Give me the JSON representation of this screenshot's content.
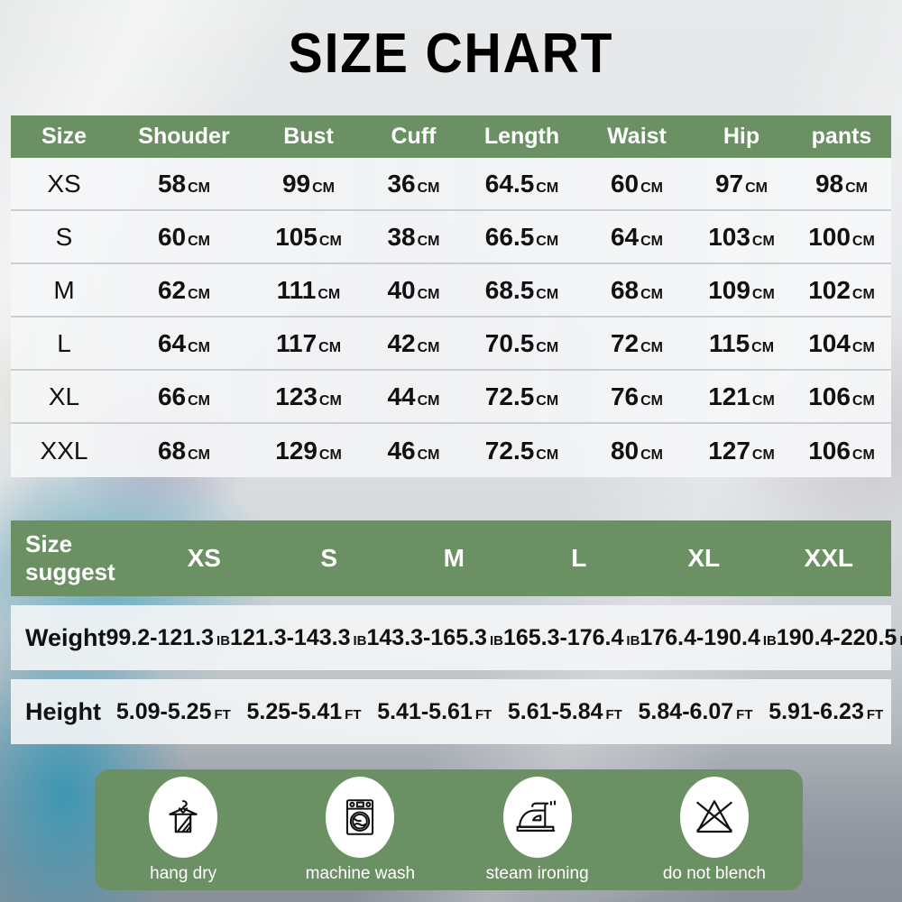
{
  "title": "SIZE CHART",
  "colors": {
    "accent_green": "#6b9063",
    "row_background": "#f3f4f6",
    "text": "#111111",
    "header_text": "#ffffff"
  },
  "size_table": {
    "columns": [
      "Size",
      "Shouder",
      "Bust",
      "Cuff",
      "Length",
      "Waist",
      "Hip",
      "pants"
    ],
    "unit": "CM",
    "rows": [
      {
        "size": "XS",
        "shouder": "58",
        "bust": "99",
        "cuff": "36",
        "length": "64.5",
        "waist": "60",
        "hip": "97",
        "pants": "98"
      },
      {
        "size": "S",
        "shouder": "60",
        "bust": "105",
        "cuff": "38",
        "length": "66.5",
        "waist": "64",
        "hip": "103",
        "pants": "100"
      },
      {
        "size": "M",
        "shouder": "62",
        "bust": "111",
        "cuff": "40",
        "length": "68.5",
        "waist": "68",
        "hip": "109",
        "pants": "102"
      },
      {
        "size": "L",
        "shouder": "64",
        "bust": "117",
        "cuff": "42",
        "length": "70.5",
        "waist": "72",
        "hip": "115",
        "pants": "104"
      },
      {
        "size": "XL",
        "shouder": "66",
        "bust": "123",
        "cuff": "44",
        "length": "72.5",
        "waist": "76",
        "hip": "121",
        "pants": "106"
      },
      {
        "size": "XXL",
        "shouder": "68",
        "bust": "129",
        "cuff": "46",
        "length": "72.5",
        "waist": "80",
        "hip": "127",
        "pants": "106"
      }
    ]
  },
  "suggest_table": {
    "header_label": "Size\nsuggest",
    "header_label_line1": "Size",
    "header_label_line2": "suggest",
    "sizes": [
      "XS",
      "S",
      "M",
      "L",
      "XL",
      "XXL"
    ],
    "weight": {
      "label": "Weight",
      "unit": "IB",
      "values": [
        "99.2-121.3",
        "121.3-143.3",
        "143.3-165.3",
        "165.3-176.4",
        "176.4-190.4",
        "190.4-220.5"
      ]
    },
    "height": {
      "label": "Height",
      "unit": "FT",
      "values": [
        "5.09-5.25",
        "5.25-5.41",
        "5.41-5.61",
        "5.61-5.84",
        "5.84-6.07",
        "5.91-6.23"
      ]
    }
  },
  "care_instructions": [
    {
      "icon": "hang-dry-icon",
      "label": "hang dry"
    },
    {
      "icon": "machine-wash-icon",
      "label": "machine wash"
    },
    {
      "icon": "steam-ironing-icon",
      "label": "steam ironing"
    },
    {
      "icon": "do-not-bleach-icon",
      "label": "do not blench"
    }
  ]
}
